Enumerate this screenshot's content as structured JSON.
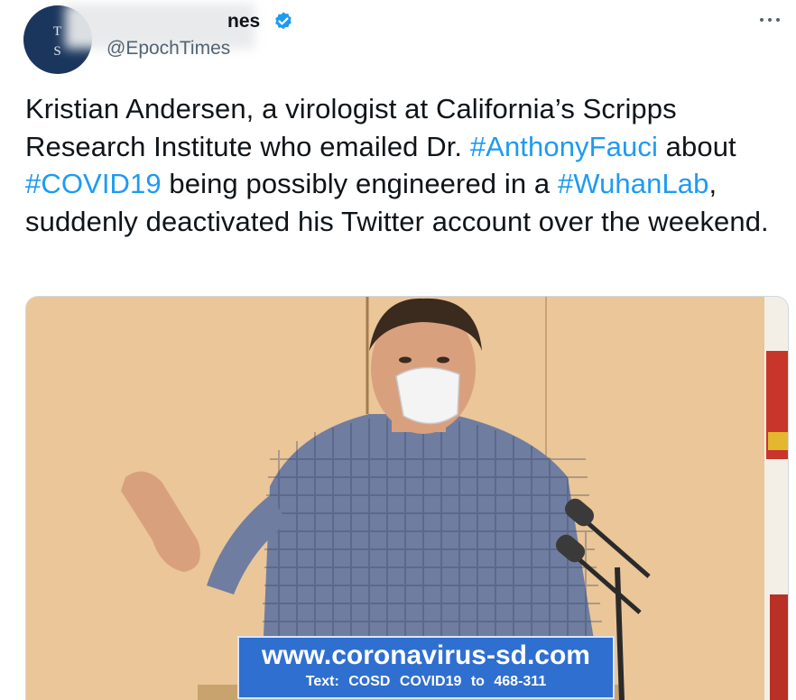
{
  "account": {
    "display_name_fragment": "nes",
    "handle": "@EpochTimes",
    "avatar_letters_top": "T",
    "avatar_letters_bottom": "S",
    "verified_color": "#1d9bf0"
  },
  "tweet": {
    "segments": [
      {
        "text": "Kristian Andersen, a virologist at California’s Scripps Research Institute who emailed Dr. ",
        "type": "text"
      },
      {
        "text": "#AnthonyFauci",
        "type": "hashtag"
      },
      {
        "text": " about ",
        "type": "text"
      },
      {
        "text": "#COVID19",
        "type": "hashtag"
      },
      {
        "text": " being possibly engineered in a ",
        "type": "text"
      },
      {
        "text": "#WuhanLab",
        "type": "hashtag"
      },
      {
        "text": ", suddenly deactivated his Twitter account over the weekend.",
        "type": "text"
      }
    ],
    "hashtag_color": "#1d9bf0"
  },
  "media": {
    "banner_url": "www.coronavirus-sd.com",
    "banner_text": "Text:  COSD  COVID19 to 468-311",
    "banner_color": "#2f6fcf",
    "wall_color": "#e6c293"
  },
  "icons": {
    "more": "more-horizontal-icon",
    "verified": "verified-badge-icon"
  }
}
